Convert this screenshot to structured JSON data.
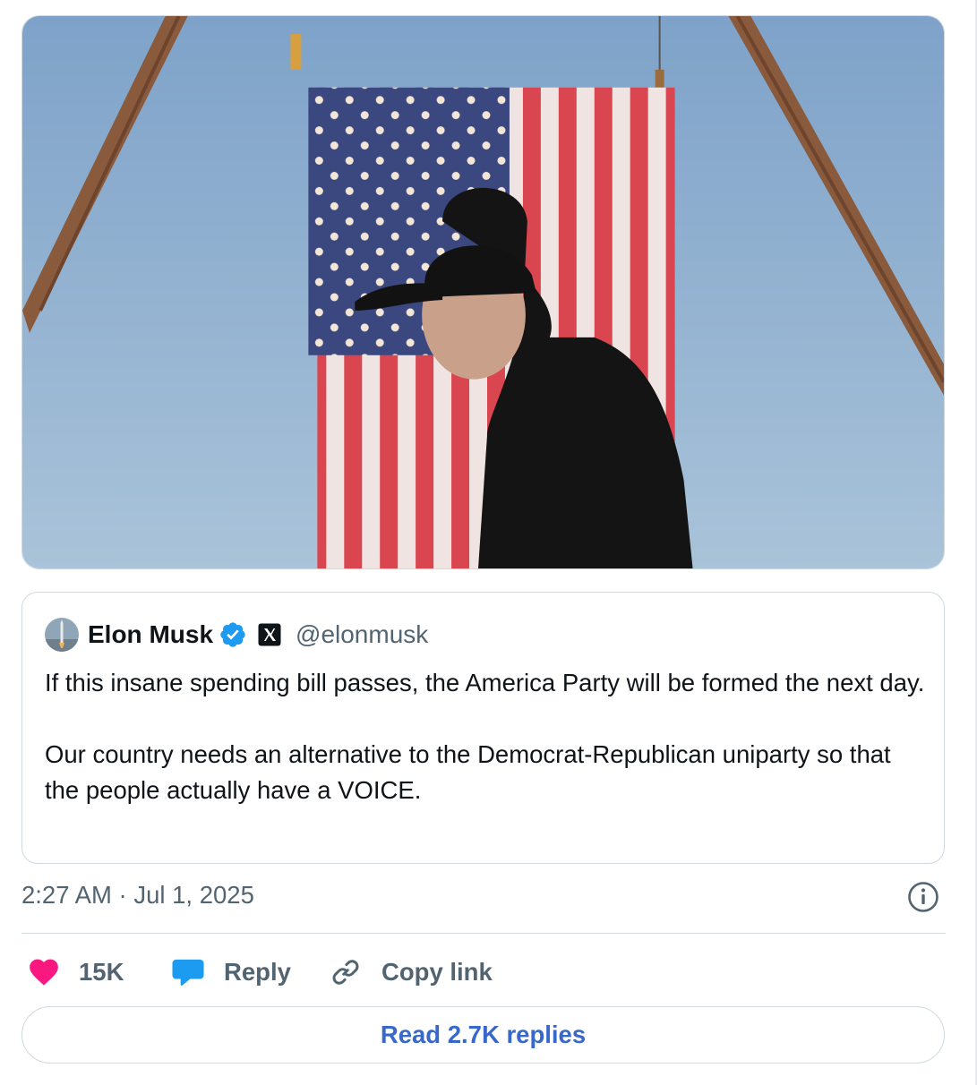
{
  "media": {
    "alt_description": ""
  },
  "quoted_tweet": {
    "author_name": "Elon Musk",
    "author_handle": "@elonmusk",
    "paragraphs": [
      "If this insane spending bill passes, the America Party will be formed the next day.",
      "Our country needs an alternative to the Democrat-Republican uniparty so that the people actually have a VOICE."
    ],
    "icons": {
      "verified": "verified-badge-icon",
      "affiliate": "x-logo-icon"
    }
  },
  "timestamp": "2:27 AM · Jul 1, 2025",
  "actions": {
    "like_count": "15K",
    "reply_label": "Reply",
    "copy_link_label": "Copy link"
  },
  "read_replies_label": "Read 2.7K replies",
  "colors": {
    "like_heart": "#f91880",
    "reply_bubble": "#1d9bf0",
    "link_blue": "#3868c9",
    "verified_blue": "#1d9bf0",
    "secondary_text": "#536471",
    "border": "#cfd9de"
  }
}
